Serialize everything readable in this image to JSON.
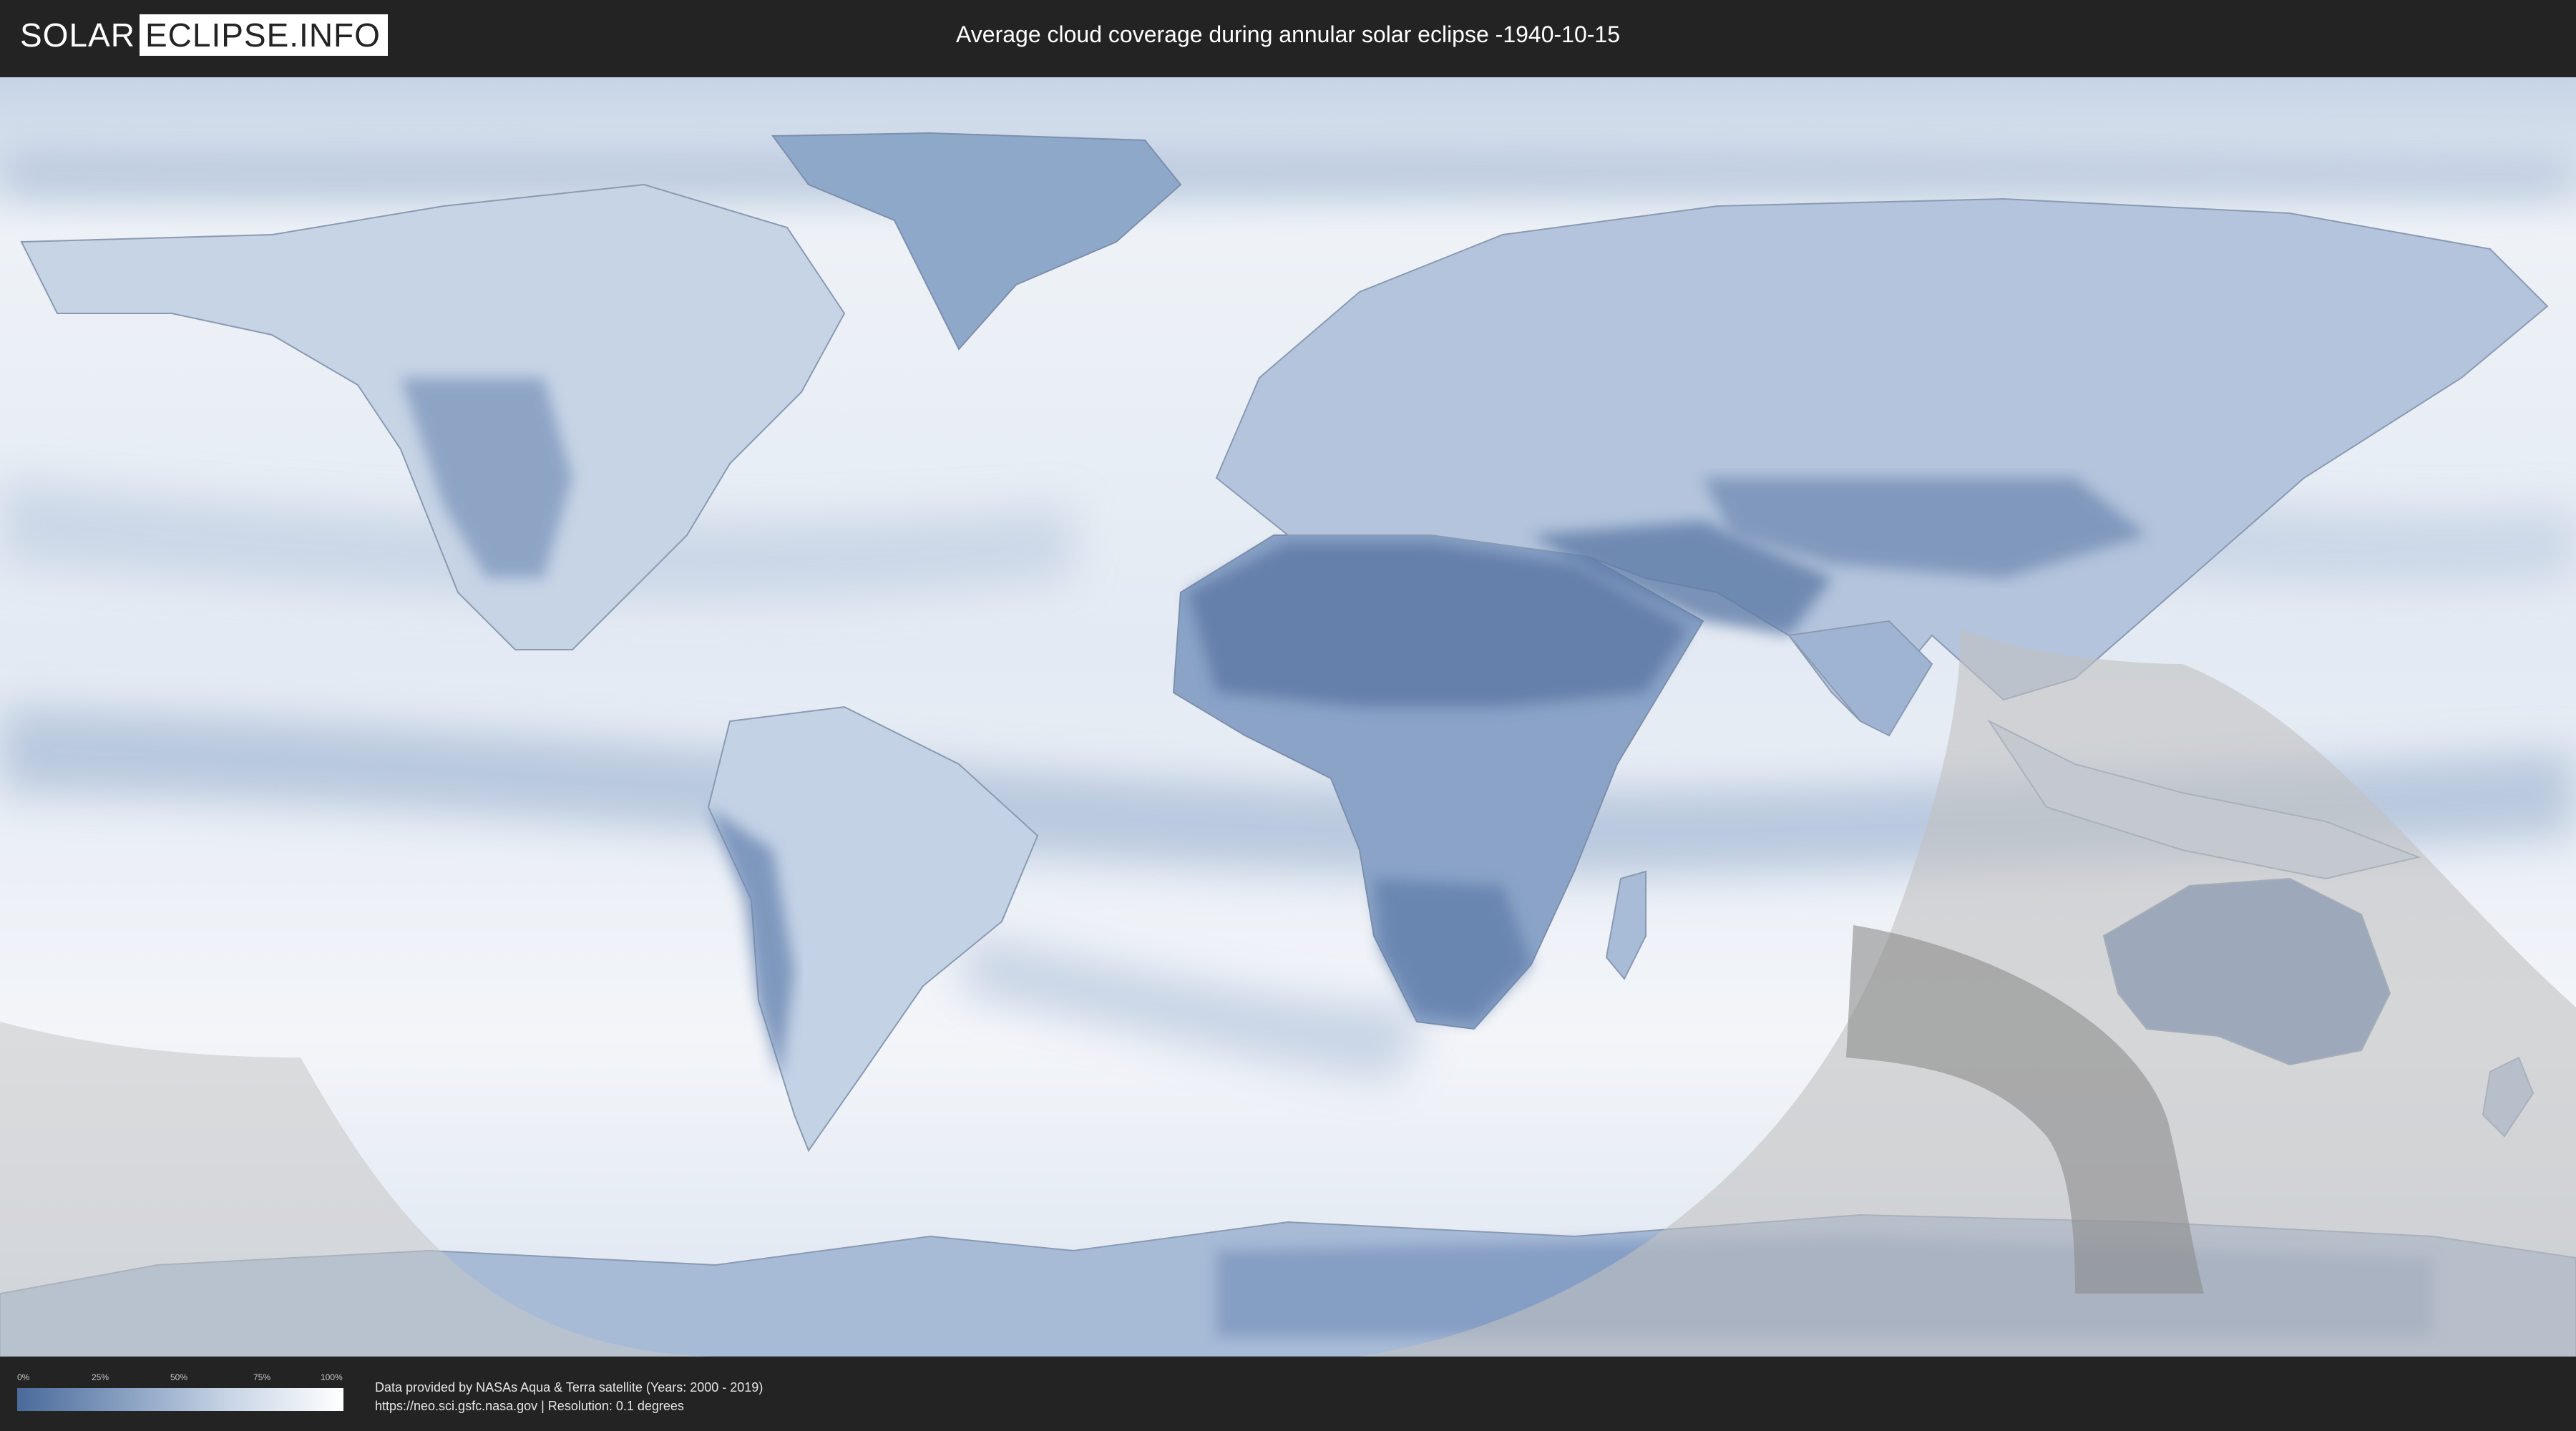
{
  "header": {
    "logo_part1": "SOLAR",
    "logo_part2": "ECLIPSE.INFO",
    "title": "Average cloud coverage during annular solar eclipse -1940-10-15"
  },
  "legend": {
    "ticks": [
      "0%",
      "25%",
      "50%",
      "75%",
      "100%"
    ],
    "colors": {
      "low": "#4a6a9a",
      "high": "#ffffff"
    }
  },
  "footer": {
    "credit_line1": "Data provided by NASAs Aqua & Terra satellite (Years: 2000 - 2019)",
    "credit_line2": "https://neo.sci.gsfc.nasa.gov | Resolution: 0.1 degrees"
  },
  "map": {
    "projection": "equirectangular",
    "colors": {
      "ocean_clear": "#f1f4f8",
      "cloud_low": "#7f98bd",
      "land_border": "#8a9ab2",
      "eclipse_zone": "#bfbfbf",
      "annular_path": "#8c8c8c"
    }
  }
}
